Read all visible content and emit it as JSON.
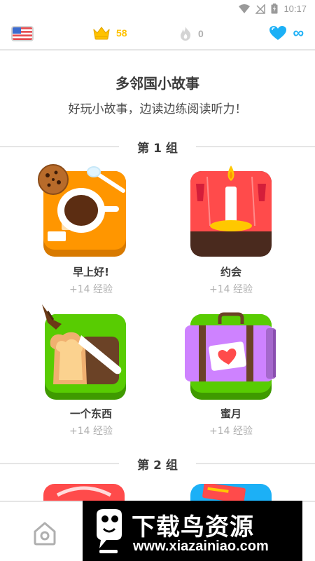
{
  "status_bar": {
    "time": "10:17"
  },
  "top_bar": {
    "course_flag": "us-flag-icon",
    "crowns": "58",
    "streak": "0",
    "hearts": "∞",
    "colors": {
      "crown": "#ffc200",
      "streak_inactive": "#afafaf",
      "heart": "#1cb0f6"
    }
  },
  "header": {
    "title": "多邻国小故事",
    "subtitle": "好玩小故事，边读边练阅读听力！"
  },
  "sections": [
    {
      "label": "第 1 组"
    },
    {
      "label": "第 2 组"
    }
  ],
  "stories": [
    {
      "title": "早上好!",
      "xp": "+14 经验",
      "icon": "coffee-cup-icon",
      "color": "#ff9600"
    },
    {
      "title": "约会",
      "xp": "+14 经验",
      "icon": "candle-icon",
      "color": "#ff4b4b"
    },
    {
      "title": "一个东西",
      "xp": "+14 经验",
      "icon": "bread-knife-icon",
      "color": "#58cc02"
    },
    {
      "title": "蜜月",
      "xp": "+14 经验",
      "icon": "suitcase-icon",
      "color": "#58cc02"
    }
  ],
  "bottom_nav": {
    "home_icon": "home-icon"
  },
  "watermark": {
    "text": "下载鸟资源",
    "url": "www.xiazainiao.com"
  }
}
